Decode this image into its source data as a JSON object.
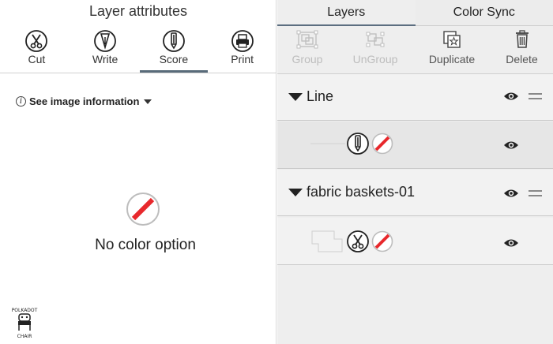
{
  "left_panel": {
    "title": "Layer attributes",
    "modes": [
      {
        "label": "Cut",
        "icon": "scissors-icon"
      },
      {
        "label": "Write",
        "icon": "pen-icon"
      },
      {
        "label": "Score",
        "icon": "score-stylus-icon"
      },
      {
        "label": "Print",
        "icon": "printer-icon"
      }
    ],
    "active_mode": "Score",
    "info_link": "See image information",
    "no_color_text": "No color option",
    "logo": "POLKADOT CHAIR"
  },
  "right_panel": {
    "tabs": [
      {
        "label": "Layers",
        "active": true
      },
      {
        "label": "Color Sync",
        "active": false
      }
    ],
    "toolbar": [
      {
        "label": "Group",
        "icon": "group-icon",
        "enabled": false
      },
      {
        "label": "UnGroup",
        "icon": "ungroup-icon",
        "enabled": false
      },
      {
        "label": "Duplicate",
        "icon": "duplicate-icon",
        "enabled": true
      },
      {
        "label": "Delete",
        "icon": "trash-icon",
        "enabled": true
      }
    ],
    "layers": [
      {
        "name": "Line",
        "child_icons": [
          "score-stylus-icon",
          "no-color-icon"
        ]
      },
      {
        "name": "fabric baskets-01",
        "child_icons": [
          "scissors-icon",
          "no-color-icon"
        ]
      }
    ]
  },
  "colors": {
    "accent": "#596b7a",
    "no_color_red": "#e8282c",
    "panel_bg": "#eeeeee",
    "selected_row": "#e6e6e6"
  }
}
